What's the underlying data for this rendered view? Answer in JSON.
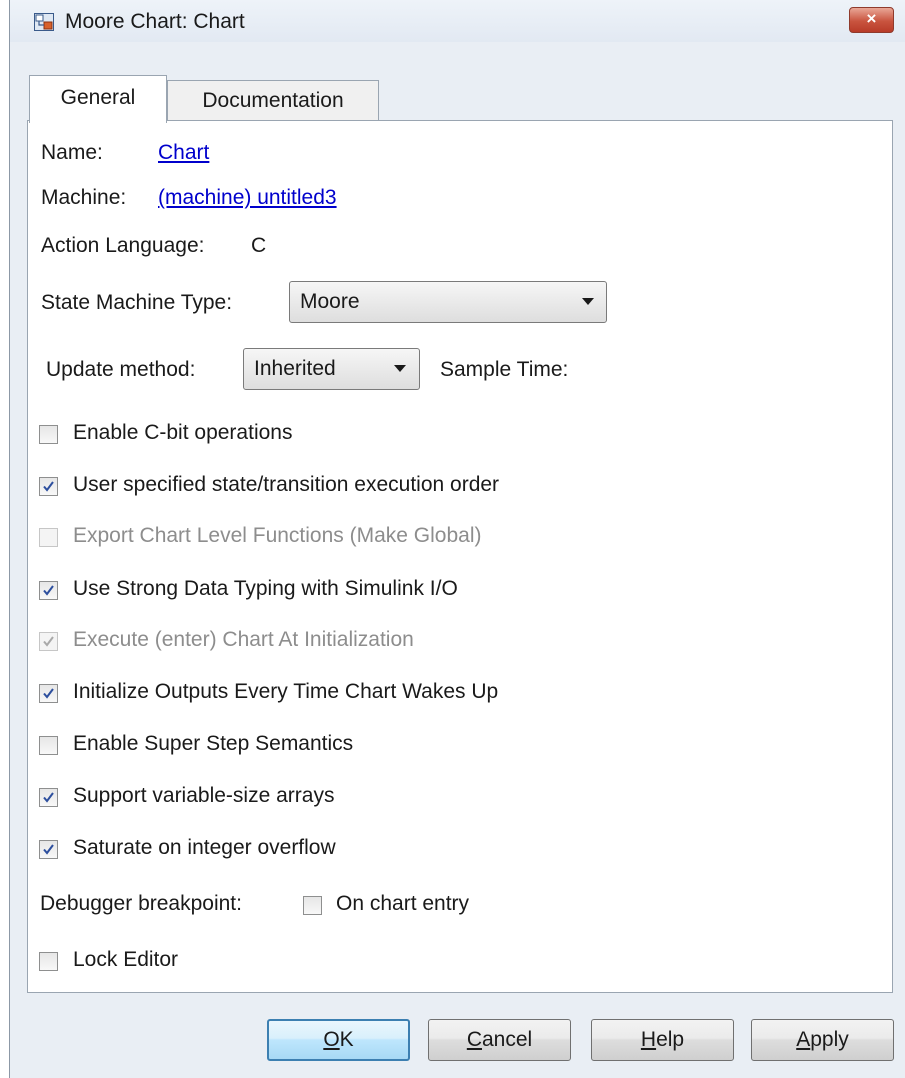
{
  "window": {
    "title": "Moore Chart: Chart",
    "close_label": "×"
  },
  "tabs": [
    {
      "label": "General",
      "selected": true
    },
    {
      "label": "Documentation",
      "selected": false
    }
  ],
  "general": {
    "name_label": "Name:",
    "name_value": "Chart",
    "machine_label": "Machine:",
    "machine_value": "(machine) untitled3",
    "action_language_label": "Action Language:",
    "action_language_value": "C",
    "state_machine_type_label": "State Machine Type:",
    "state_machine_type_value": "Moore",
    "update_method_label": "Update method:",
    "update_method_value": "Inherited",
    "sample_time_label": "Sample Time:",
    "sample_time_value": ""
  },
  "checkboxes": [
    {
      "label": "Enable C-bit operations",
      "checked": false,
      "enabled": true
    },
    {
      "label": "User specified state/transition execution order",
      "checked": true,
      "enabled": true
    },
    {
      "label": "Export Chart Level Functions (Make Global)",
      "checked": false,
      "enabled": false
    },
    {
      "label": "Use Strong Data Typing with Simulink I/O",
      "checked": true,
      "enabled": true
    },
    {
      "label": "Execute (enter) Chart At Initialization",
      "checked": true,
      "enabled": false
    },
    {
      "label": "Initialize Outputs Every Time Chart Wakes Up",
      "checked": true,
      "enabled": true
    },
    {
      "label": "Enable Super Step Semantics",
      "checked": false,
      "enabled": true
    },
    {
      "label": "Support variable-size arrays",
      "checked": true,
      "enabled": true
    },
    {
      "label": "Saturate on integer overflow",
      "checked": true,
      "enabled": true
    }
  ],
  "debugger": {
    "label": "Debugger breakpoint:",
    "option_label": "On chart entry",
    "checked": false
  },
  "lock_editor": {
    "label": "Lock Editor",
    "checked": false
  },
  "buttons": {
    "ok": {
      "mnemonic": "O",
      "rest": "K"
    },
    "cancel": {
      "mnemonic": "C",
      "rest": "ancel"
    },
    "help": {
      "mnemonic": "H",
      "rest": "elp"
    },
    "apply": {
      "mnemonic": "A",
      "rest": "pply"
    }
  },
  "colors": {
    "link": "#0000cc",
    "check": "#2d4f9e",
    "close_button": "#c9543f",
    "default_button_border": "#3c7fb1"
  }
}
